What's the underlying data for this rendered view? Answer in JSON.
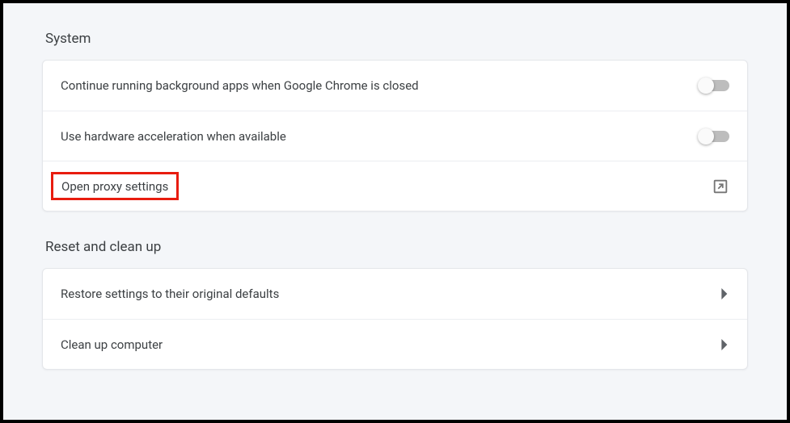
{
  "sections": {
    "system": {
      "title": "System",
      "rows": {
        "background_apps": {
          "label": "Continue running background apps when Google Chrome is closed",
          "toggle": false
        },
        "hardware_accel": {
          "label": "Use hardware acceleration when available",
          "toggle": false
        },
        "proxy": {
          "label": "Open proxy settings"
        }
      }
    },
    "reset": {
      "title": "Reset and clean up",
      "rows": {
        "restore": {
          "label": "Restore settings to their original defaults"
        },
        "cleanup": {
          "label": "Clean up computer"
        }
      }
    }
  }
}
